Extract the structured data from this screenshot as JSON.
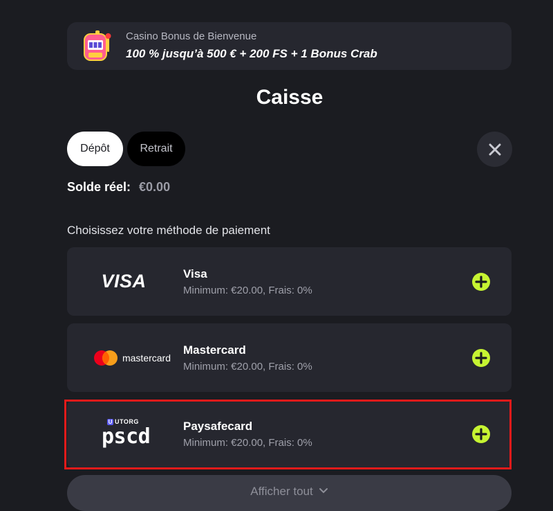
{
  "banner": {
    "subtitle": "Casino Bonus de Bienvenue",
    "offer": "100 % jusqu’à 500 € + 200 FS + 1 Bonus Crab",
    "icon": "slot-machine-icon"
  },
  "page_title": "Caisse",
  "tabs": [
    {
      "label": "Dépôt",
      "active": true
    },
    {
      "label": "Retrait",
      "active": false
    }
  ],
  "close_icon": "close-icon",
  "balance": {
    "label": "Solde réel:",
    "value": "€0.00"
  },
  "choose_method": "Choisissez votre méthode de paiement",
  "methods": [
    {
      "name": "Visa",
      "details": "Minimum: €20.00, Frais: 0%",
      "logo": "VISA"
    },
    {
      "name": "Mastercard",
      "details": "Minimum: €20.00, Frais: 0%",
      "logo": "mastercard"
    },
    {
      "name": "Paysafecard",
      "details": "Minimum: €20.00, Frais: 0%",
      "logo": "pscd",
      "logo_badge": "UTORG",
      "highlighted": true
    }
  ],
  "show_all": "Afficher tout",
  "colors": {
    "background": "#1b1c21",
    "card": "#26272f",
    "accent_green": "#c6f432",
    "highlight_red": "#e41a1a"
  }
}
